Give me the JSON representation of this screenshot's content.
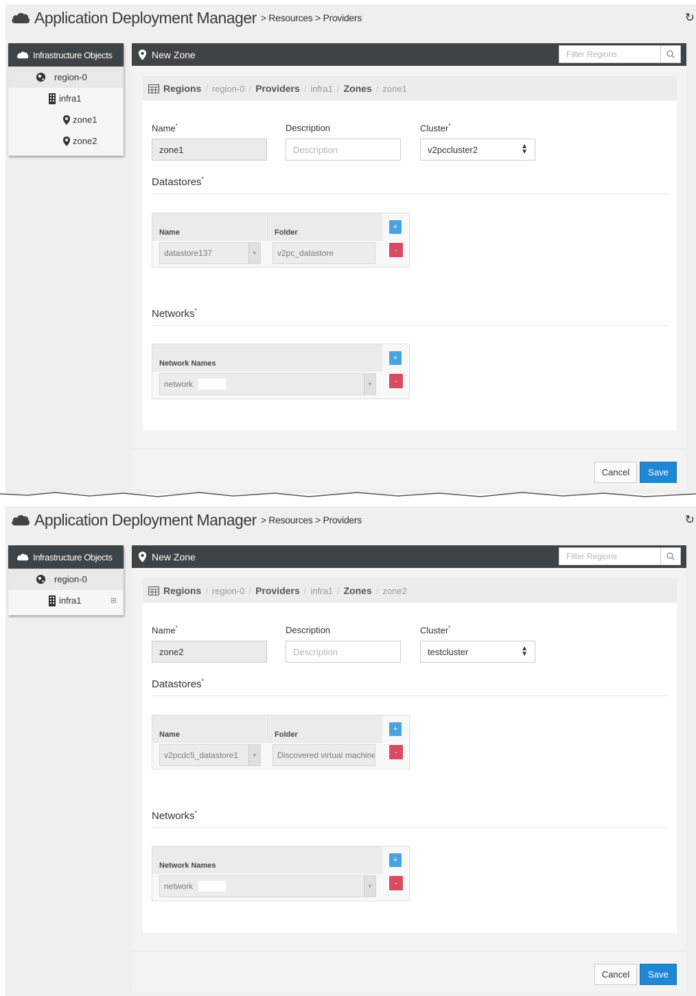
{
  "app": {
    "title": "Application Deployment Manager",
    "breadcrumb": "> Resources > Providers"
  },
  "colors": {
    "header": "#3d4347",
    "save": "#1e88d4",
    "add": "#4aa3df",
    "remove": "#d94b62"
  },
  "screens": [
    {
      "sidebar": {
        "header": "Infrastructure Objects",
        "items": [
          {
            "label": "region-0",
            "icon": "globe-icon"
          },
          {
            "label": "infra1",
            "icon": "building-icon"
          },
          {
            "label": "zone1",
            "icon": "map-pin-icon"
          },
          {
            "label": "zone2",
            "icon": "map-pin-icon"
          }
        ]
      },
      "panel": {
        "title": "New Zone",
        "filter_placeholder": "Filter Regions",
        "crumbs": {
          "regions": "Regions",
          "region": "region-0",
          "providers": "Providers",
          "provider": "infra1",
          "zones": "Zones",
          "zone": "zone1"
        },
        "form": {
          "name_label": "Name",
          "name_value": "zone1",
          "description_label": "Description",
          "description_placeholder": "Description",
          "cluster_label": "Cluster",
          "cluster_value": "v2pccluster2"
        },
        "datastores": {
          "title": "Datastores",
          "col_name": "Name",
          "col_folder": "Folder",
          "row": {
            "name": "datastore137",
            "folder": "v2pc_datastore"
          }
        },
        "networks": {
          "title": "Networks",
          "col_name": "Network Names",
          "row": {
            "name": "network"
          }
        },
        "add_label": "+",
        "remove_label": "-",
        "cancel": "Cancel",
        "save": "Save"
      }
    },
    {
      "sidebar": {
        "header": "Infrastructure Objects",
        "items": [
          {
            "label": "region-0",
            "icon": "globe-icon"
          },
          {
            "label": "infra1",
            "icon": "building-icon",
            "toggle": "⊞"
          }
        ]
      },
      "panel": {
        "title": "New Zone",
        "filter_placeholder": "Filter Regions",
        "crumbs": {
          "regions": "Regions",
          "region": "region-0",
          "providers": "Providers",
          "provider": "infra1",
          "zones": "Zones",
          "zone": "zone2"
        },
        "form": {
          "name_label": "Name",
          "name_value": "zone2",
          "description_label": "Description",
          "description_placeholder": "Description",
          "cluster_label": "Cluster",
          "cluster_value": "testcluster"
        },
        "datastores": {
          "title": "Datastores",
          "col_name": "Name",
          "col_folder": "Folder",
          "row": {
            "name": "v2pcdc5_datastore1",
            "folder": "Discovered virtual machine"
          }
        },
        "networks": {
          "title": "Networks",
          "col_name": "Network Names",
          "row": {
            "name": "network"
          }
        },
        "add_label": "+",
        "remove_label": "-",
        "cancel": "Cancel",
        "save": "Save"
      }
    }
  ]
}
